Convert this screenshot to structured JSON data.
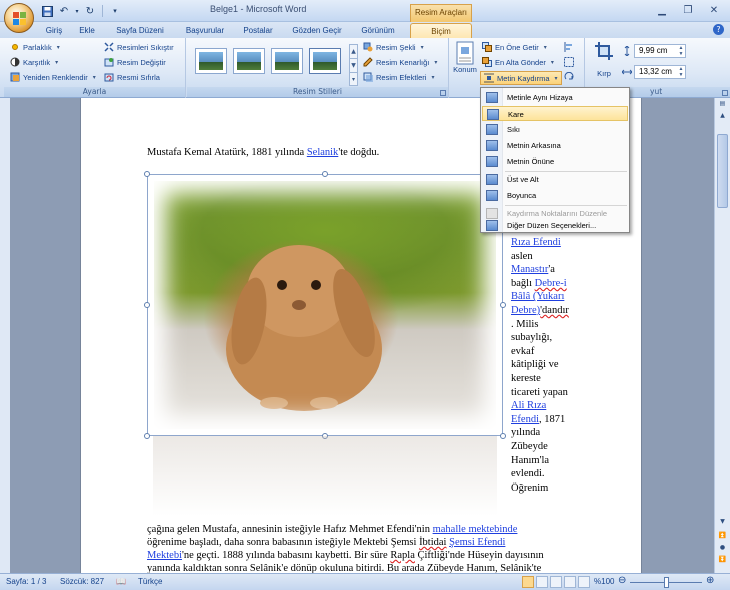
{
  "title": {
    "window_title": "Belge1 - Microsoft Word",
    "context_group": "Resim Araçları"
  },
  "tabs": [
    "Giriş",
    "Ekle",
    "Sayfa Düzeni",
    "Başvurular",
    "Postalar",
    "Gözden Geçir",
    "Görünüm",
    "Biçim"
  ],
  "ribbon": {
    "ayarla": {
      "label": "Ayarla",
      "parlaklik": "Parlaklık",
      "karsitlik": "Karşıtlık",
      "yeniden_renklendir": "Yeniden Renklendir",
      "sikistir": "Resimleri Sıkıştır",
      "degistir": "Resim Değiştir",
      "sifirla": "Resmi Sıfırla"
    },
    "stiller": {
      "label": "Resim Stilleri",
      "sekli": "Resim Şekli",
      "kenarligi": "Resim Kenarlığı",
      "efektleri": "Resim Efektleri"
    },
    "yerlestir": {
      "konum": "Konum",
      "en_one": "En Öne Getir",
      "en_alta": "En Alta Gönder",
      "metin_kaydirma": "Metin Kaydırma"
    },
    "boyut": {
      "kirp": "Kırp",
      "height": "9,99 cm",
      "width": "13,32 cm",
      "label_tail": "yut"
    }
  },
  "menu": {
    "items": [
      "Metinle Aynı Hizaya",
      "Kare",
      "Sıkı",
      "Metnin Arkasına",
      "Metnin Önüne",
      "Üst ve Alt",
      "Boyunca",
      "Kaydırma Noktalarını Düzenle",
      "Diğer Düzen Seçenekleri..."
    ]
  },
  "document": {
    "line1_a": "Mustafa Kemal Atatürk, 1881 yılında ",
    "line1_link": "Selanik",
    "line1_b": "'te doğdu.",
    "side": {
      "s1": "Rıza Efendi",
      "s2": "aslen",
      "s3": "Manastır",
      "s3b": "'a",
      "s4a": "bağlı ",
      "s4b": "Debre-i",
      "s5": "Bâlâ (Yukarı",
      "s6a": "Debre)",
      "s6b": "'dandır",
      "s7": ". Milis",
      "s8": "subaylığı,",
      "s9": "evkaf",
      "s10": "kâtipliği ve",
      "s11": "kereste",
      "s12": "ticareti yapan",
      "s13": "Ali Rıza",
      "s14a": "Efendi",
      "s14b": ", 1871",
      "s15": "yılında",
      "s16": "Zübeyde",
      "s17": "Hanım'la",
      "s18": "evlendi.",
      "s19": "Öğrenim"
    },
    "p2_l1a": "çağına gelen Mustafa, annesinin isteğiyle Hafız Mehmet Efendi'nin ",
    "p2_l1link": "mahalle mektebinde",
    "p2_l2a": "öğrenime başladı, daha sonra babasının isteğiyle Mektebi Şemsi ",
    "p2_l2b": "İbtidai",
    "p2_l2c": " ",
    "p2_l2link": "Şemsi Efendi",
    "p2_l3link": "Mektebi",
    "p2_l3a": "'ne geçti. 1888 yılında babasını kaybetti. Bir süre ",
    "p2_l3b": "Rapla",
    "p2_l3c": " Çiftliği'nde Hüseyin dayısının",
    "p2_l4": "yanında kaldıktan sonra Selânik'e dönüp okuluna bitirdi. Bu arada Zübeyde Hanım, Selânik'te"
  },
  "status": {
    "page": "Sayfa: 1 / 3",
    "words": "Sözcük: 827",
    "lang": "Türkçe",
    "zoom": "%100"
  }
}
